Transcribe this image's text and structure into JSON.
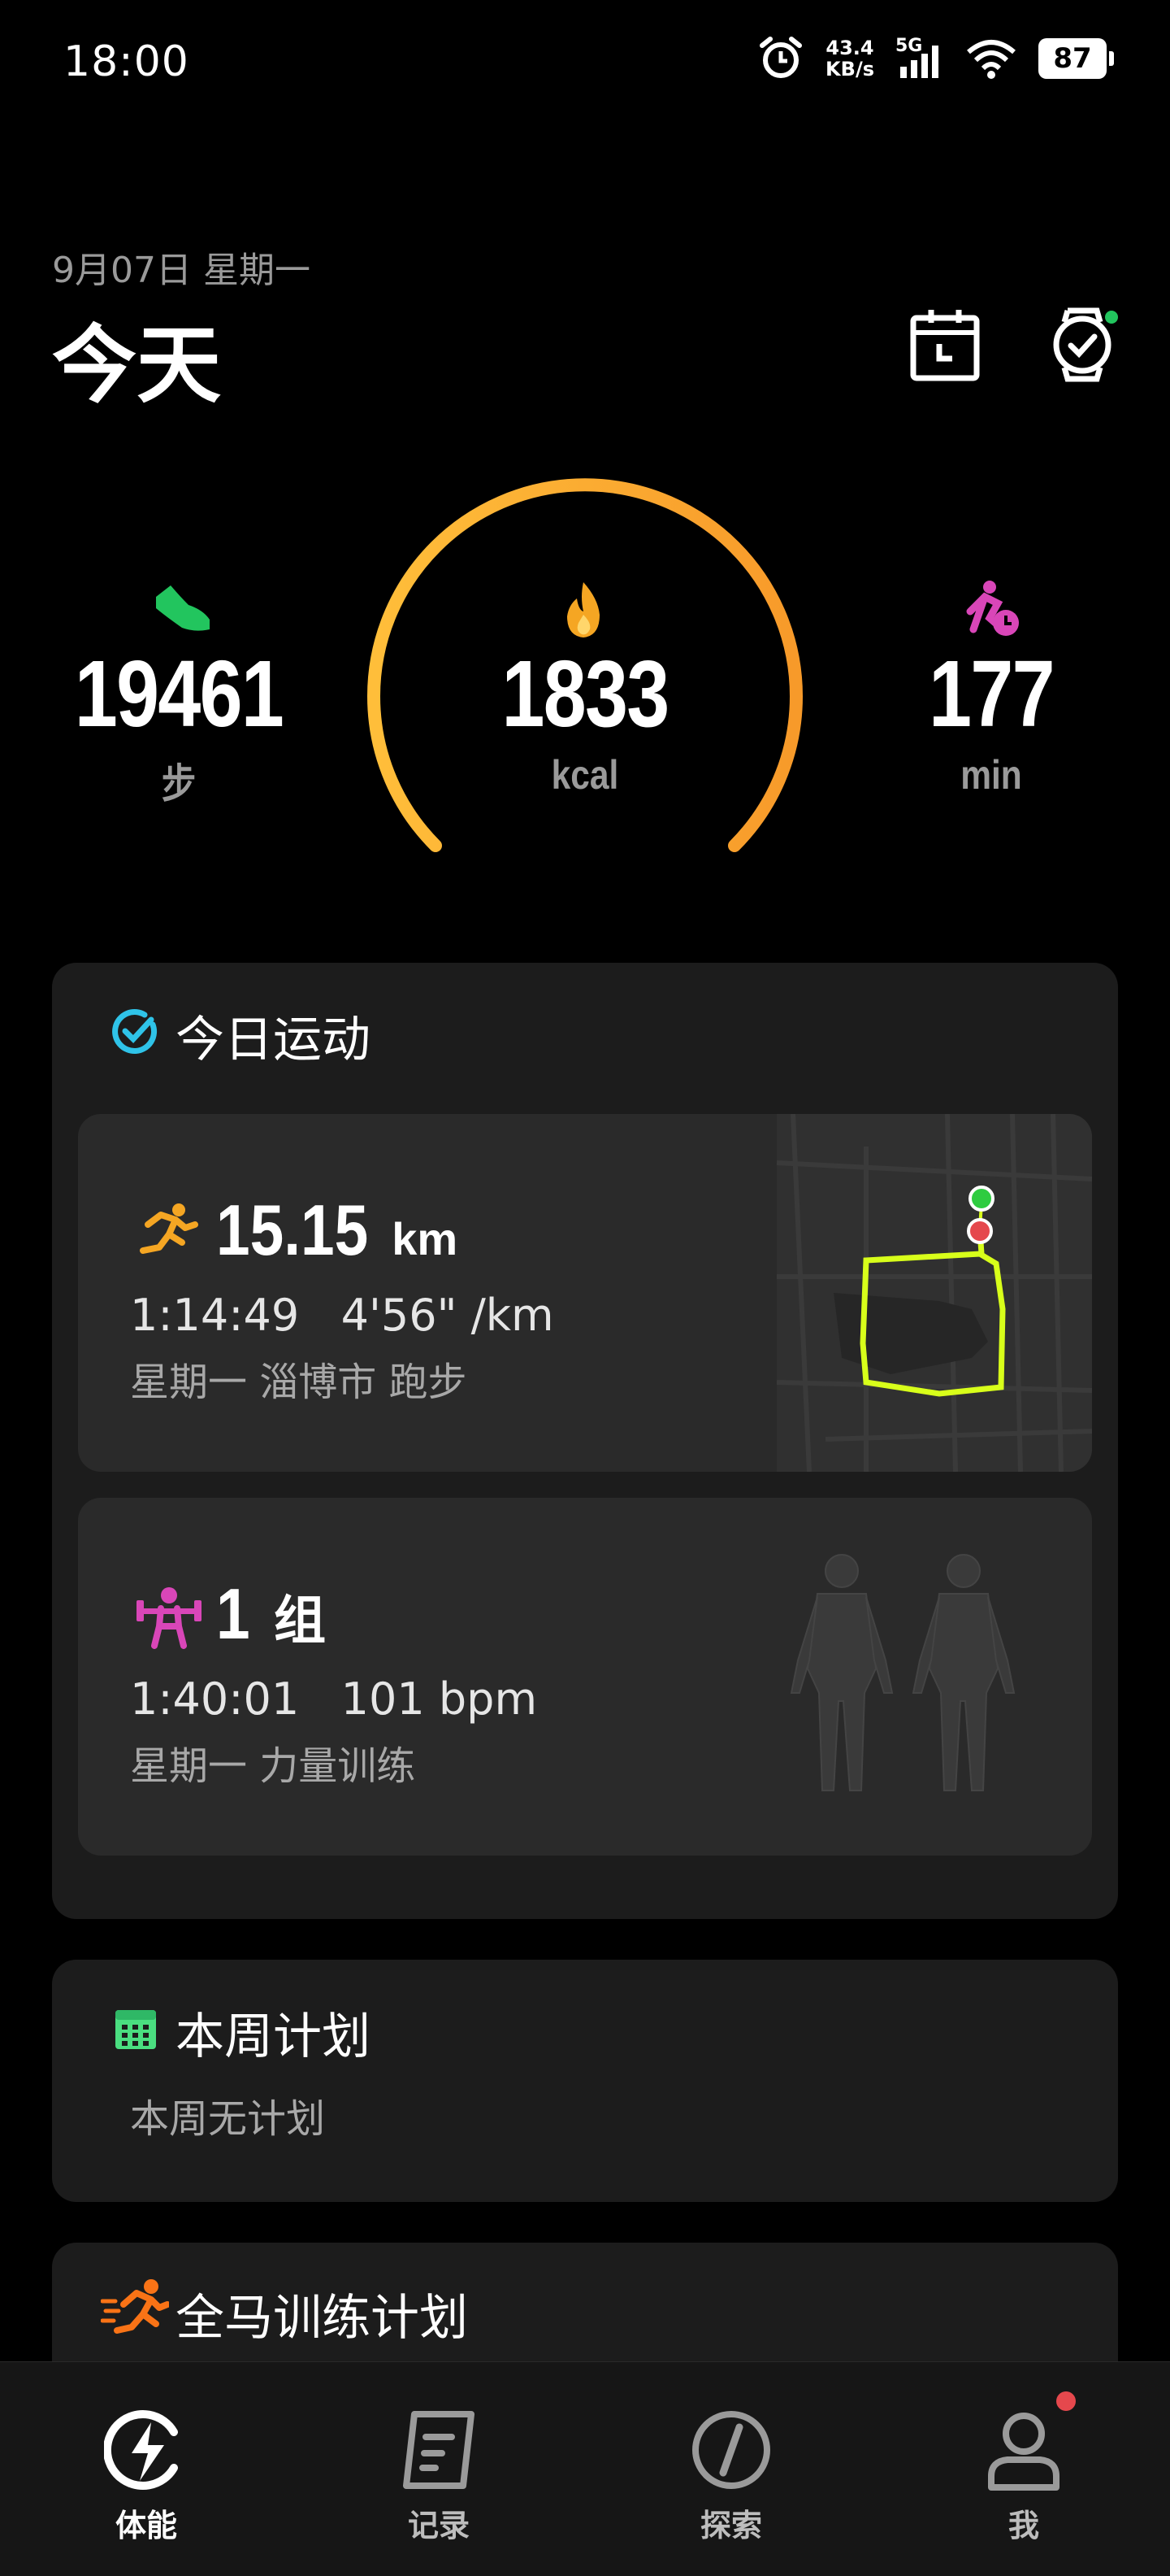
{
  "status_bar": {
    "time": "18:00",
    "net_speed_value": "43.4",
    "net_speed_unit": "KB/s",
    "network": "5G",
    "battery": "87"
  },
  "header": {
    "date": "9月07日 星期一",
    "title": "今天"
  },
  "metrics": {
    "steps": {
      "value": "19461",
      "unit": "步",
      "icon": "shoe-icon",
      "color": "#22c55e"
    },
    "calories": {
      "value": "1833",
      "unit": "kcal",
      "icon": "flame-icon",
      "color": "#f5a623"
    },
    "minutes": {
      "value": "177",
      "unit": "min",
      "icon": "active-time-icon",
      "color": "#d946b8"
    }
  },
  "today_workouts": {
    "title": "今日运动",
    "items": [
      {
        "value": "15.15",
        "unit": "km",
        "duration": "1:14:49",
        "detail": "4'56\" /km",
        "meta": "星期一  淄博市 跑步",
        "icon": "running-icon",
        "color": "#f5a623"
      },
      {
        "value": "1",
        "unit": "组",
        "duration": "1:40:01",
        "detail": "101 bpm",
        "meta": "星期一  力量训练",
        "icon": "weightlifting-icon",
        "color": "#d946b8"
      }
    ]
  },
  "weekly_plan": {
    "title": "本周计划",
    "empty_text": "本周无计划",
    "icon": "calendar-grid-icon",
    "color": "#4ade80"
  },
  "marathon_plan": {
    "title": "全马训练计划",
    "icon": "sprint-icon",
    "color": "#f97316"
  },
  "bottom_nav": [
    {
      "label": "体能",
      "icon": "lightning-icon",
      "active": true
    },
    {
      "label": "记录",
      "icon": "records-icon",
      "active": false
    },
    {
      "label": "探索",
      "icon": "compass-icon",
      "active": false
    },
    {
      "label": "我",
      "icon": "profile-icon",
      "active": false,
      "badge": true
    }
  ],
  "colors": {
    "accent_ring_start": "#ffb436",
    "accent_ring_end": "#f79a2a",
    "route_line": "#d8ff1a",
    "badge_red": "#e5484d"
  }
}
